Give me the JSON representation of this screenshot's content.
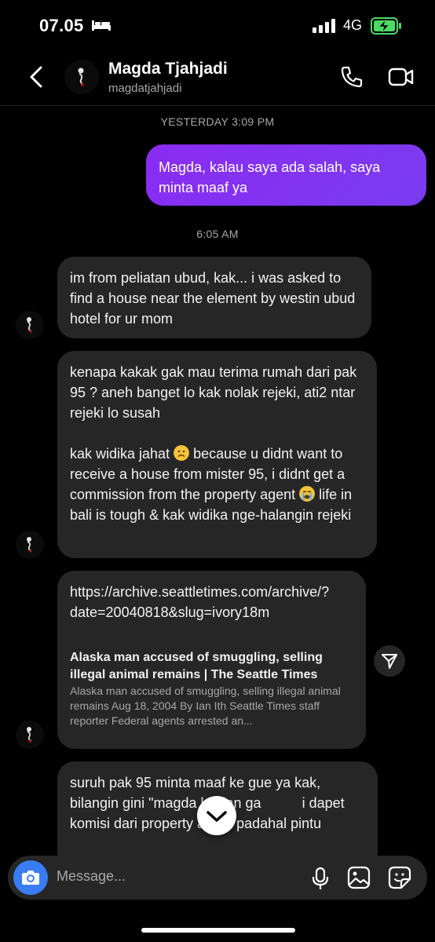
{
  "status_bar": {
    "time": "07.05",
    "network": "4G"
  },
  "header": {
    "name": "Magda Tjahjadi",
    "username": "magdatjahjadi"
  },
  "timestamps": {
    "first": "YESTERDAY 3:09 PM",
    "second": "6:05 AM"
  },
  "messages": {
    "outgoing_1": "Magda, kalau saya ada salah, saya minta maaf ya",
    "incoming_1": "im from peliatan ubud, kak... i was asked to find a house near the element by westin ubud hotel for ur mom",
    "incoming_2": {
      "para1": "kenapa kakak gak mau terima rumah dari pak 95 ? aneh banget lo kak nolak rejeki, ati2 ntar rejeki lo susah",
      "para2_a": "kak widika jahat ",
      "para2_b": " because u didnt want to receive a house from mister 95, i didnt get a commission from the property agent ",
      "para2_c": " life in bali is tough & kak widika nge-halangin rejeki"
    },
    "link": {
      "url": "https://archive.seattletimes.com/archive/?date=20040818&slug=ivory18m",
      "title": "Alaska man accused of smuggling, selling illegal animal remains | The Seattle Times",
      "description": "Alaska man accused of smuggling, selling illegal animal remains Aug 18, 2004 By Ian Ith Seattle Times staff reporter Federal agents arrested an..."
    },
    "incoming_4": "suruh pak 95 minta maaf ke gue ya kak, bilangin gini \"magda kasian ga",
    "incoming_4_rest": "i dapet komisi dari property agent padahal pintu"
  },
  "composer": {
    "placeholder": "Message..."
  },
  "icons": {
    "back": "chevron-left-icon",
    "call": "phone-icon",
    "video": "video-camera-icon",
    "camera": "camera-icon",
    "mic": "microphone-icon",
    "gallery": "image-icon",
    "sticker": "sticker-icon",
    "share": "paper-plane-icon",
    "scroll": "chevron-down-icon"
  },
  "colors": {
    "outgoing_bubble": "#8a2bf2",
    "incoming_bubble": "#262626",
    "camera_button": "#3a7cf5",
    "battery": "#4cd964"
  }
}
